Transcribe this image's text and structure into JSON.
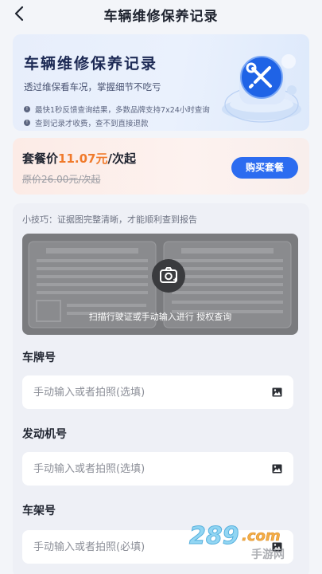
{
  "header": {
    "title": "车辆维修保养记录",
    "back_icon": "chevron-left-icon"
  },
  "hero": {
    "title": "车辆维修保养记录",
    "subtitle": "透过维保看车况，掌握细节不吃亏",
    "items": [
      "最快1秒反馈查询结果，多数品牌支持7x24小时查询",
      "查到记录才收费，查不到直接退款"
    ],
    "item_icon": "info-icon",
    "illustration_icon": "wrench-screwdriver-icon"
  },
  "pricing": {
    "label": "套餐价",
    "amount": "11.07元",
    "unit": "/次起",
    "original": "原价26.00元/次起",
    "buy_label": "购买套餐",
    "accent": "#f07a2b",
    "button_color": "#2c6cf0"
  },
  "form": {
    "tip": "小技巧：证据图完整清晰，才能顺利查到报告",
    "scan_hint": "扫描行驶证或手动输入进行 授权查询",
    "camera_icon": "camera-scan-icon",
    "fields": [
      {
        "label": "车牌号",
        "placeholder": "手动输入或者拍照(选填)",
        "icon": "image-icon"
      },
      {
        "label": "发动机号",
        "placeholder": "手动输入或者拍照(选填)",
        "icon": "image-icon"
      },
      {
        "label": "车架号",
        "placeholder": "手动输入或者拍照(必填)",
        "icon": "image-icon"
      }
    ]
  },
  "watermark": {
    "text": "289.com",
    "sub": "手游网"
  }
}
